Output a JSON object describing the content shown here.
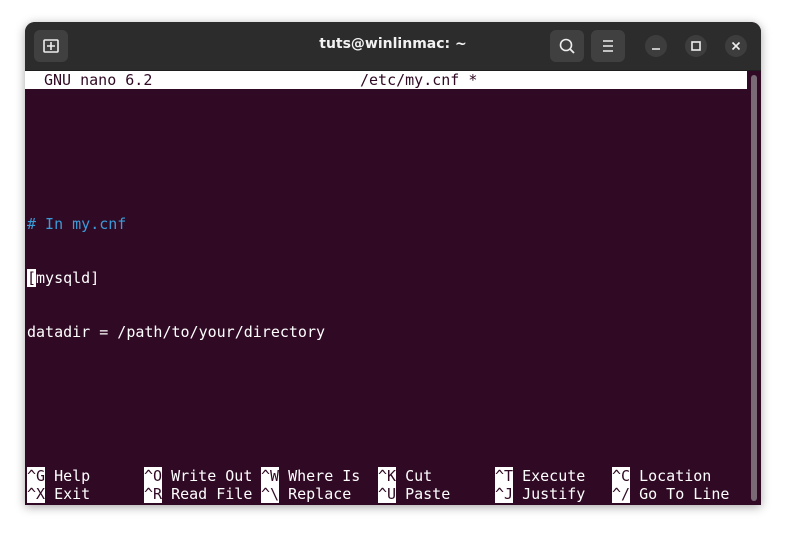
{
  "window": {
    "title": "tuts@winlinmac: ~"
  },
  "editor": {
    "version": "GNU nano 6.2",
    "filename": "/etc/my.cnf *",
    "comment_line": "# In my.cnf",
    "cursor_char": "[",
    "section_rest": "mysqld]",
    "datadir_line": "datadir = /path/to/your/directory"
  },
  "shortcuts_row1": [
    {
      "key": "^G",
      "label": "Help"
    },
    {
      "key": "^O",
      "label": "Write Out"
    },
    {
      "key": "^W",
      "label": "Where Is"
    },
    {
      "key": "^K",
      "label": "Cut"
    },
    {
      "key": "^T",
      "label": "Execute"
    },
    {
      "key": "^C",
      "label": "Location"
    }
  ],
  "shortcuts_row2": [
    {
      "key": "^X",
      "label": "Exit"
    },
    {
      "key": "^R",
      "label": "Read File"
    },
    {
      "key": "^\\",
      "label": "Replace"
    },
    {
      "key": "^U",
      "label": "Paste"
    },
    {
      "key": "^J",
      "label": "Justify"
    },
    {
      "key": "^/",
      "label": "Go To Line"
    }
  ],
  "icons": [
    "new-tab-icon",
    "search-icon",
    "menu-icon",
    "minimize-icon",
    "maximize-icon",
    "close-icon"
  ],
  "colors": {
    "terminal_bg": "#300a24",
    "comment": "#3a9bd9",
    "titlebar": "#2c2c2c"
  }
}
